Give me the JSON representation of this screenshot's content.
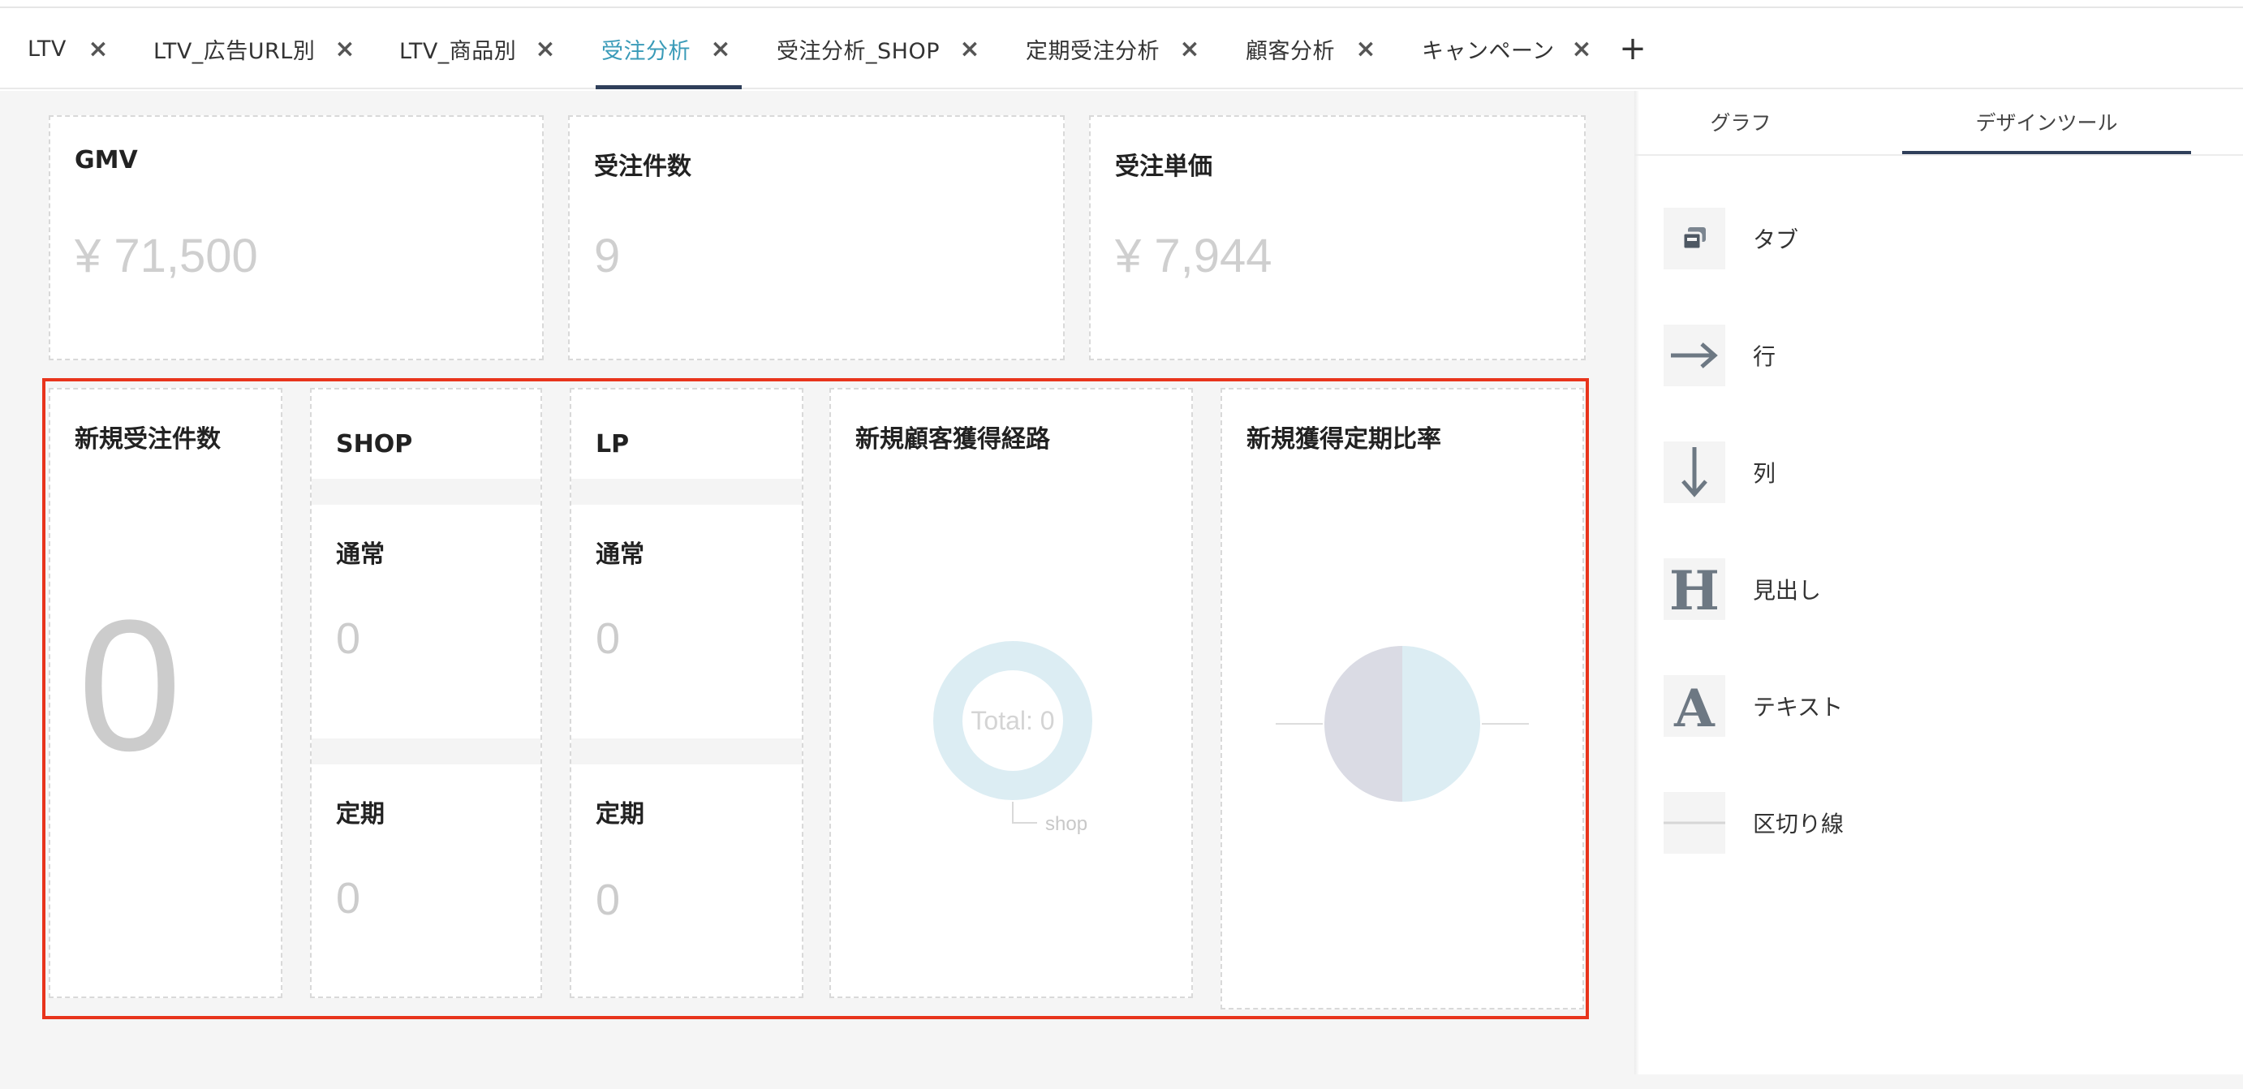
{
  "tabs": [
    {
      "label": "LTV",
      "active": false
    },
    {
      "label": "LTV_広告URL別",
      "active": false
    },
    {
      "label": "LTV_商品別",
      "active": false
    },
    {
      "label": "受注分析",
      "active": true
    },
    {
      "label": "受注分析_SHOP",
      "active": false
    },
    {
      "label": "定期受注分析",
      "active": false
    },
    {
      "label": "顧客分析",
      "active": false
    },
    {
      "label": "キャンペーン",
      "active": false
    }
  ],
  "tab_close_glyph": "×",
  "tab_add_glyph": "+",
  "kpis": {
    "gmv": {
      "title": "GMV",
      "value": "¥ 71,500"
    },
    "orders": {
      "title": "受注件数",
      "value": "9"
    },
    "unit_price": {
      "title": "受注単価",
      "value": "¥ 7,944"
    }
  },
  "new_orders": {
    "title": "新規受注件数",
    "value": "0"
  },
  "shop": {
    "title": "SHOP",
    "normal": {
      "title": "通常",
      "value": "0"
    },
    "subscription": {
      "title": "定期",
      "value": "0"
    }
  },
  "lp": {
    "title": "LP",
    "normal": {
      "title": "通常",
      "value": "0"
    },
    "subscription": {
      "title": "定期",
      "value": "0"
    }
  },
  "acquisition": {
    "title": "新規顧客獲得経路",
    "center_label": "Total: 0",
    "legend_label": "shop"
  },
  "subscription_ratio": {
    "title": "新規獲得定期比率"
  },
  "chart_data": [
    {
      "type": "pie",
      "variant": "donut",
      "title": "新規顧客獲得経路",
      "center_label": "Total: 0",
      "slices": [
        {
          "label": "shop",
          "value": 0
        }
      ],
      "colors": [
        "#dcedf3"
      ]
    },
    {
      "type": "pie",
      "title": "新規獲得定期比率",
      "slices": [
        {
          "value": 0
        },
        {
          "value": 0
        }
      ],
      "colors": [
        "#dadbe4",
        "#dcedf3"
      ]
    }
  ],
  "panel": {
    "tabs": [
      {
        "label": "グラフ",
        "active": false
      },
      {
        "label": "デザインツール",
        "active": true
      }
    ],
    "tools": [
      {
        "label": "タブ",
        "icon": "tab-icon"
      },
      {
        "label": "行",
        "icon": "arrow-right-icon"
      },
      {
        "label": "列",
        "icon": "arrow-down-icon"
      },
      {
        "label": "見出し",
        "icon": "heading-icon"
      },
      {
        "label": "テキスト",
        "icon": "text-icon"
      },
      {
        "label": "区切り線",
        "icon": "divider-icon"
      }
    ]
  },
  "colors": {
    "accent": "#3a9bb8",
    "tab_underline": "#2f3f5a",
    "highlight_border": "#e8341c",
    "placeholder_value": "#cccccc",
    "chart_blue": "#dcedf3",
    "chart_grey": "#dadbe4"
  }
}
